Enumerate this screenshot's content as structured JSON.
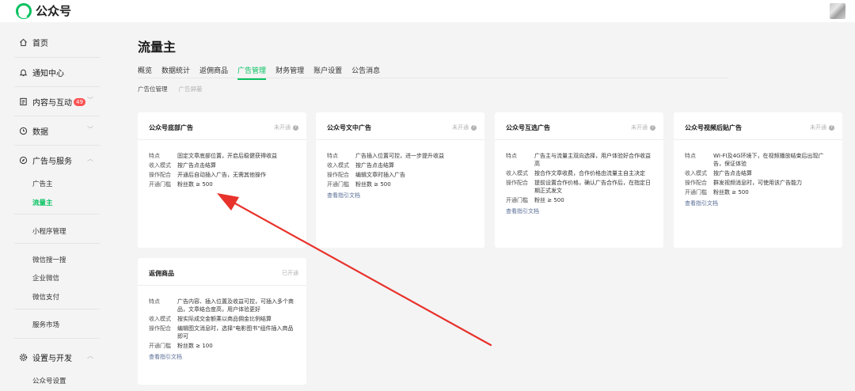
{
  "header": {
    "brand": "公众号"
  },
  "sidebar": {
    "items": [
      {
        "label": "首页",
        "icon": "home-icon"
      },
      {
        "label": "通知中心",
        "icon": "bell-icon"
      },
      {
        "label": "内容与互动",
        "badge": "49",
        "icon": "document-icon"
      },
      {
        "label": "数据",
        "icon": "clock-icon"
      },
      {
        "label": "广告与服务",
        "icon": "compass-icon"
      },
      {
        "label": "设置与开发",
        "icon": "gear-icon"
      }
    ],
    "sub": {
      "ad_host": "广告主",
      "traffic_host": "流量主",
      "mini_program": "小程序管理",
      "wechat_search": "微信搜一搜",
      "wecom": "企业微信",
      "wechat_pay": "微信支付",
      "service_market": "服务市场",
      "account_settings": "公众号设置"
    }
  },
  "main": {
    "title": "流量主",
    "tabs": [
      "概览",
      "数据统计",
      "返佣商品",
      "广告管理",
      "财务管理",
      "账户设置",
      "公告消息"
    ],
    "active_tab": "广告管理",
    "subtabs": [
      "广告位管理",
      "广告屏蔽"
    ]
  },
  "cards": [
    {
      "title": "公众号底部广告",
      "status": "未开通",
      "rows": [
        {
          "label": "特点",
          "value": "固定文章底部位置，开启后稳健获得收益"
        },
        {
          "label": "收入模式",
          "value": "按广告点击结算"
        },
        {
          "label": "操作配合",
          "value": "开通后自动插入广告，无需其他操作"
        },
        {
          "label": "开通门槛",
          "value": "粉丝数 ≥ 500"
        }
      ],
      "link": ""
    },
    {
      "title": "公众号文中广告",
      "status": "未开通",
      "rows": [
        {
          "label": "特点",
          "value": "广告插入位置可控，进一步提升收益"
        },
        {
          "label": "收入模式",
          "value": "按广告点击结算"
        },
        {
          "label": "操作配合",
          "value": "编辑文章时插入广告"
        },
        {
          "label": "开通门槛",
          "value": "粉丝数 ≥ 500"
        }
      ],
      "link": "查看指引文档"
    },
    {
      "title": "公众号互选广告",
      "status": "未开通",
      "rows": [
        {
          "label": "特点",
          "value": "广告主与流量主双向选择，用户体验好合作收益高"
        },
        {
          "label": "收入模式",
          "value": "按合作文章收费，合作价格由流量主自主决定"
        },
        {
          "label": "操作配合",
          "value": "提前设置合作价格，确认广告合作后，在指定日期正式发文"
        },
        {
          "label": "开通门槛",
          "value": "粉丝 ≥ 500"
        }
      ],
      "link": "查看指引文档"
    },
    {
      "title": "公众号视频后贴广告",
      "status": "未开通",
      "rows": [
        {
          "label": "特点",
          "value": "WI-FI及4G环境下，在视频播放结束后出现广告，保证体验"
        },
        {
          "label": "收入模式",
          "value": "按广告点击结算"
        },
        {
          "label": "操作配合",
          "value": "群发视频消息时，可使用该广告能力"
        },
        {
          "label": "开通门槛",
          "value": "粉丝数 ≥ 500"
        }
      ],
      "link": "查看指引文档"
    },
    {
      "title": "返佣商品",
      "status": "已开通",
      "rows": [
        {
          "label": "特点",
          "value": "广告内容、插入位置及收益可控，可插入多个商品，文章结合度高，用户体验更好"
        },
        {
          "label": "收入模式",
          "value": "按实际成交金额乘以商品佣金比例结算"
        },
        {
          "label": "操作配合",
          "value": "编辑图文消息时，选择\"电影图书\"组件插入商品即可"
        },
        {
          "label": "开通门槛",
          "value": "粉丝数 ≥ 100"
        }
      ],
      "link": "查看指引文档"
    }
  ],
  "colors": {
    "accent": "#07c160",
    "link": "#576b95",
    "annotation_arrow": "#e8322b"
  }
}
